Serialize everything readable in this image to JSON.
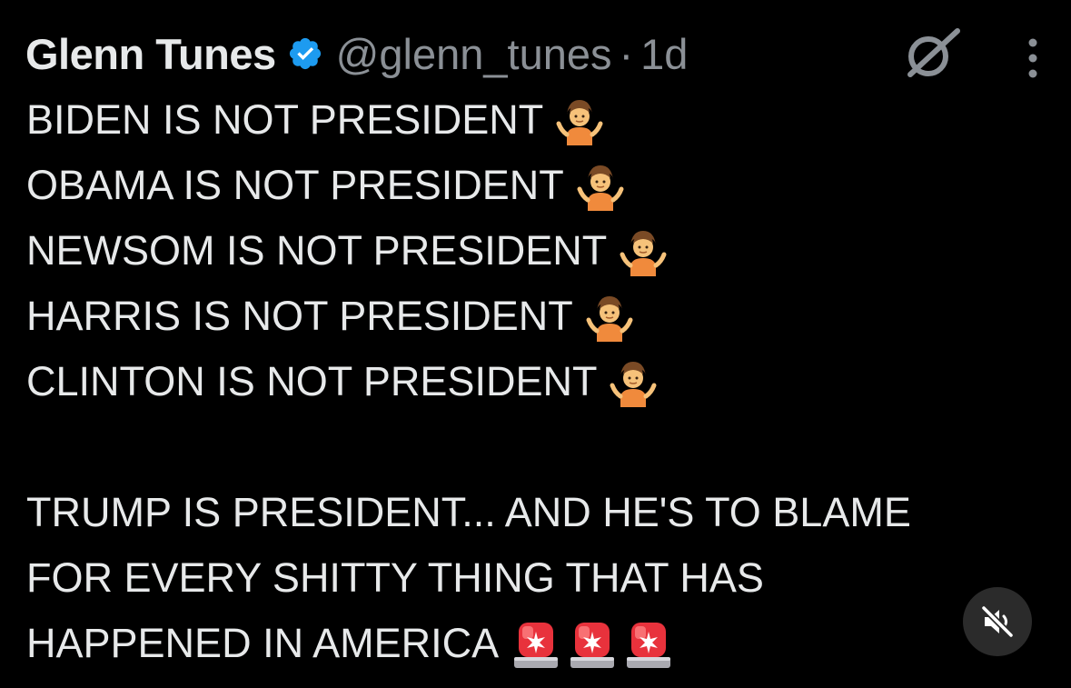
{
  "tweet": {
    "author": {
      "display_name": "Glenn Tunes",
      "handle": "@glenn_tunes",
      "verified": true,
      "verified_color": "#1d9bf0"
    },
    "separator": "·",
    "timestamp": "1d",
    "lines": [
      {
        "text": "BIDEN IS NOT PRESIDENT",
        "emoji": "person-shrugging"
      },
      {
        "text": "OBAMA IS NOT PRESIDENT",
        "emoji": "person-shrugging"
      },
      {
        "text": "NEWSOM IS NOT PRESIDENT",
        "emoji": "person-shrugging"
      },
      {
        "text": "HARRIS IS NOT PRESIDENT",
        "emoji": "person-shrugging"
      },
      {
        "text": "CLINTON IS NOT PRESIDENT",
        "emoji": "person-shrugging"
      }
    ],
    "closing_lines": [
      "TRUMP IS PRESIDENT... AND HE'S TO BLAME",
      "FOR EVERY SHITTY THING THAT HAS",
      "HAPPENED IN AMERICA"
    ],
    "closing_emoji": [
      "police-car-light",
      "police-car-light",
      "police-car-light"
    ]
  },
  "icons": {
    "grok": "grok-icon",
    "more": "more-options-icon",
    "mute": "muted-speaker-icon"
  },
  "colors": {
    "background": "#000000",
    "text_primary": "#e7e9ea",
    "text_secondary": "#8b9096",
    "mute_button_bg": "#2b2b2b"
  }
}
